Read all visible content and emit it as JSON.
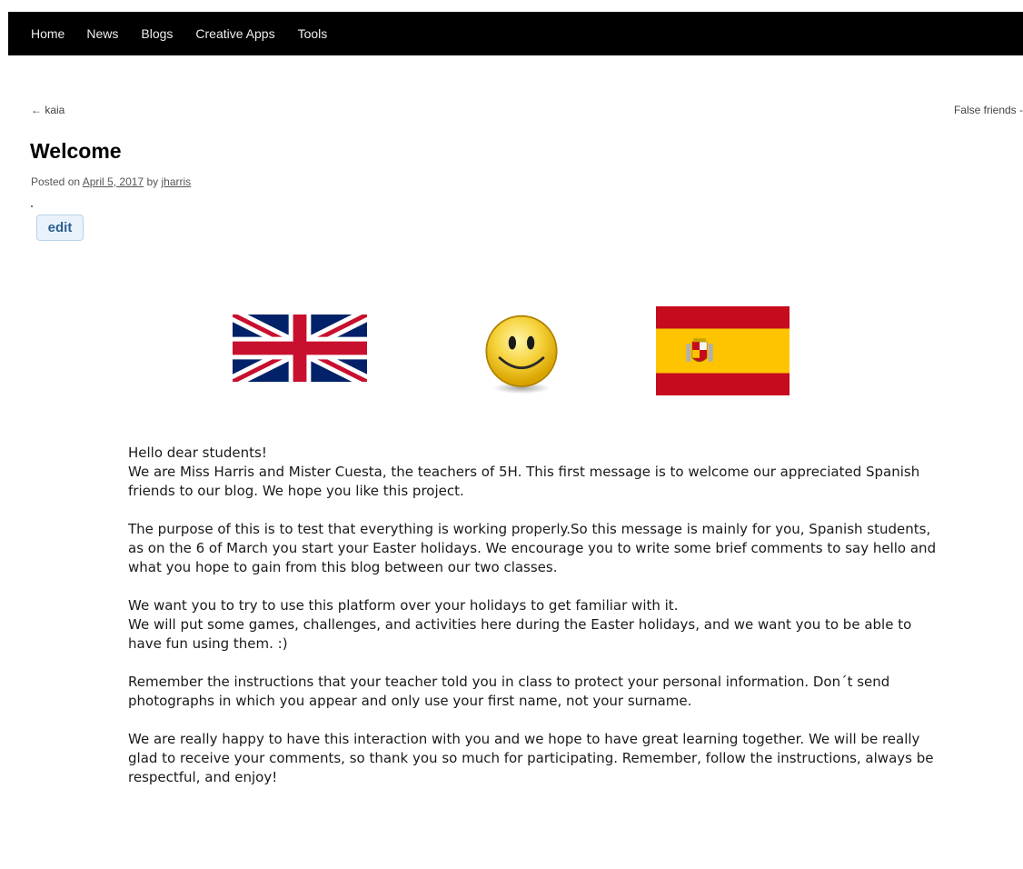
{
  "nav": {
    "items": [
      "Home",
      "News",
      "Blogs",
      "Creative Apps",
      "Tools"
    ]
  },
  "post_nav": {
    "previous": "← kaia",
    "next": "False friends -"
  },
  "post": {
    "title": "Welcome",
    "meta_prefix": "Posted on",
    "date": "April 5, 2017",
    "meta_by": "by",
    "author": "jharris",
    "edit_label": "edit"
  },
  "images": {
    "flag_uk": "uk-flag",
    "smiley": "smiley-face",
    "flag_es": "spain-flag"
  },
  "body": {
    "greeting": "Hello dear students!",
    "p1": "We are Miss Harris and Mister Cuesta, the teachers of 5H. This first message is to welcome our appreciated Spanish friends to our blog. We hope you like this project.",
    "p2": "The purpose of this is to test that everything is working properly.So this message is mainly for you, Spanish students, as on the 6 of March you start your Easter holidays. We encourage you to write some brief comments to say hello and what you hope to gain from this blog between our two classes.",
    "p3a": "We want you to try to use this platform over your holidays to get familiar with it.",
    "p3b": "We will put some games, challenges, and activities here during the Easter holidays, and we want you to be able to have fun using them. :)",
    "p4": "Remember the instructions that your teacher told you in class to protect your personal information. Don´t send photographs in which you appear and only use your first name, not your surname.",
    "p5": "We are really happy to have this interaction with you and we hope to have great learning together. We will be really glad to receive your comments, so thank you so much for participating. Remember, follow the instructions, always be respectful, and enjoy!"
  },
  "colors": {
    "nav_bg": "#000000",
    "edit_bg": "#e9f2fb",
    "edit_text": "#2b5f8f"
  }
}
